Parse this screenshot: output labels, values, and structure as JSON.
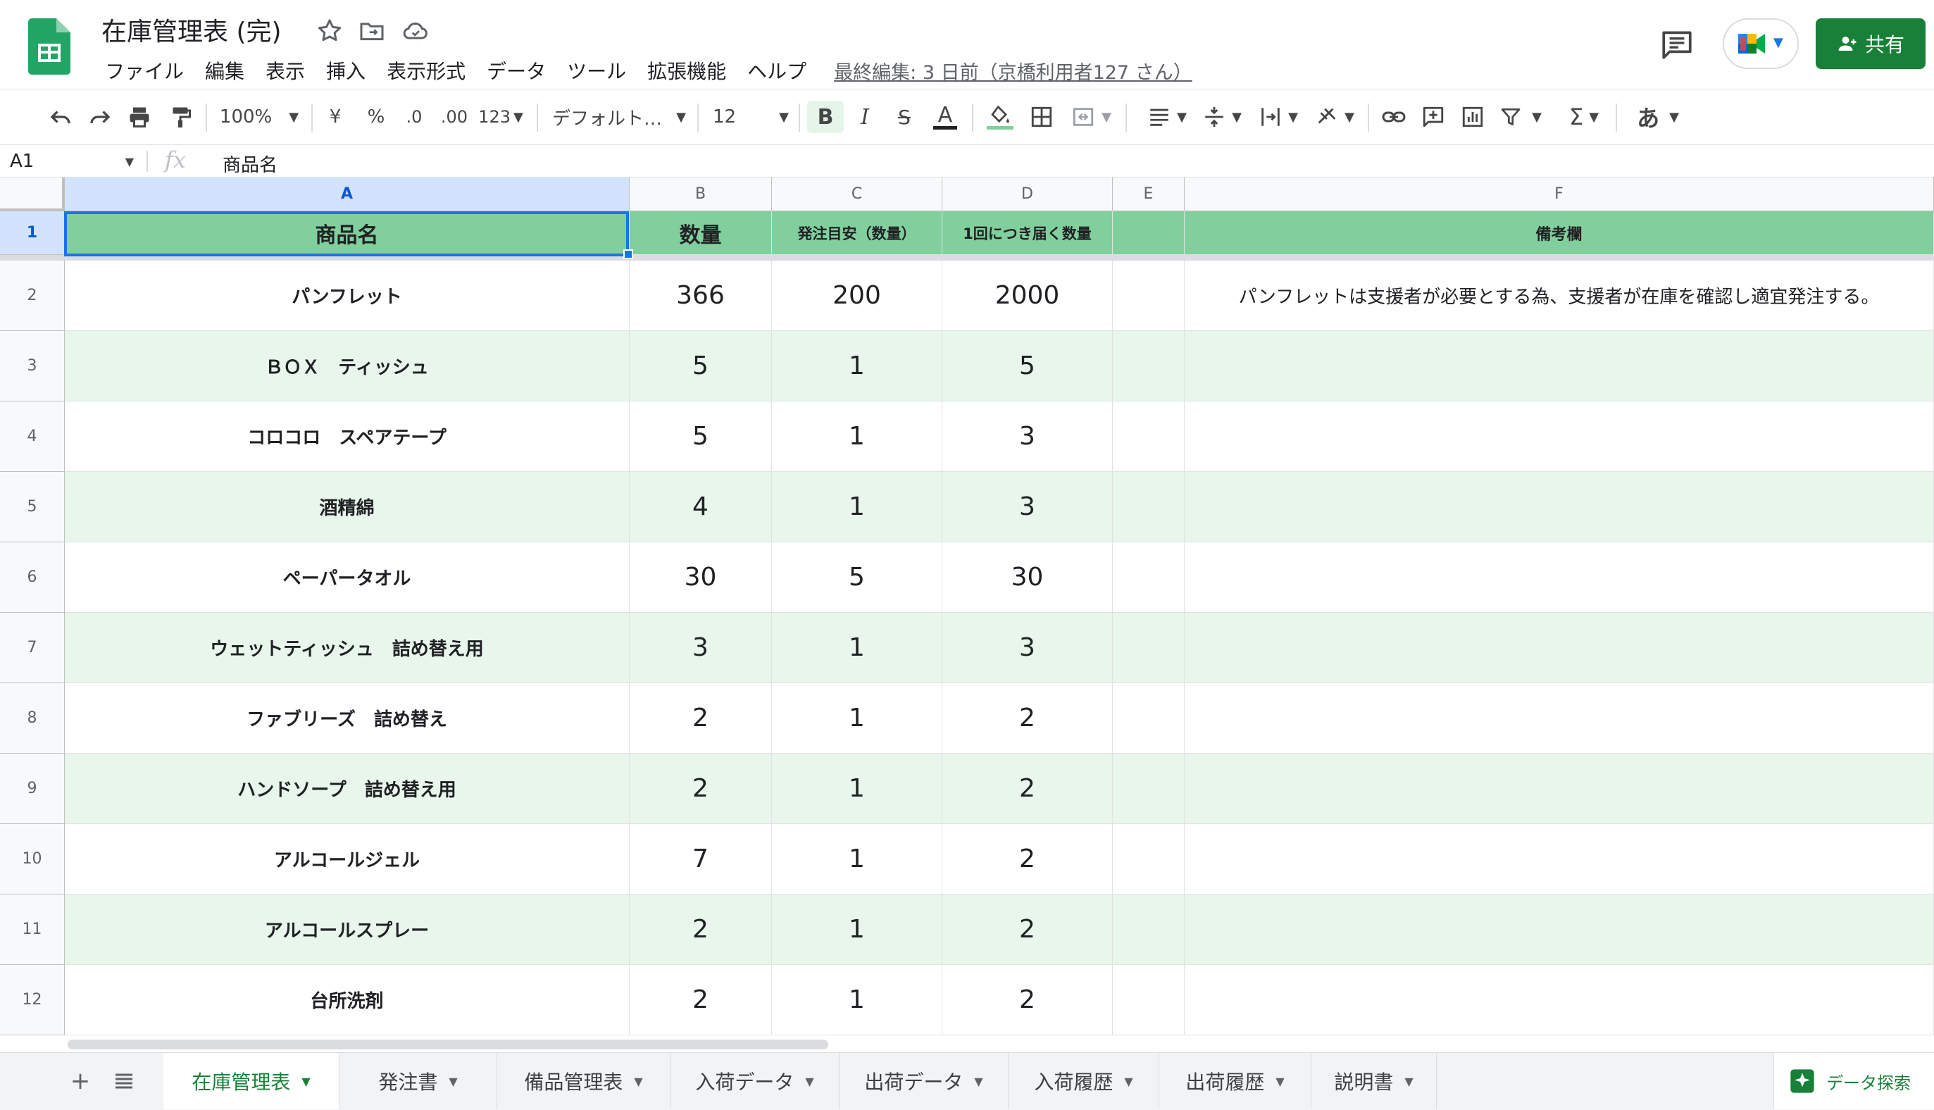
{
  "app": {
    "doc_title": "在庫管理表 (完)",
    "menu": [
      "ファイル",
      "編集",
      "表示",
      "挿入",
      "表示形式",
      "データ",
      "ツール",
      "拡張機能",
      "ヘルプ"
    ],
    "last_edit": "最終編集: 3 日前（京橋利用者127 さん）",
    "share_label": "共有",
    "accent_green": "#188038"
  },
  "toolbar": {
    "zoom": "100%",
    "currency": "¥",
    "percent": "%",
    "decrease_decimal": ".0",
    "increase_decimal": ".00",
    "more_formats": "123",
    "font_family": "デフォルト…",
    "font_size": "12",
    "bold": "B",
    "italic": "I",
    "strike": "S",
    "text_color": "A",
    "sum": "Σ",
    "input_tools": "あ"
  },
  "formula_bar": {
    "cell_ref": "A1",
    "fx": "fx",
    "content": "商品名"
  },
  "sheet": {
    "columns": [
      "A",
      "B",
      "C",
      "D",
      "E",
      "F"
    ],
    "header_row": {
      "row_number": "1",
      "name": "商品名",
      "qty": "数量",
      "order_point": "発注目安（数量）",
      "per_delivery": "1回につき届く数量",
      "e": "",
      "note": "備考欄"
    },
    "rows": [
      {
        "n": "2",
        "name": "パンフレット",
        "qty": "366",
        "order_point": "200",
        "per_delivery": "2000",
        "note": "パンフレットは支援者が必要とする為、支援者が在庫を確認し適宜発注する。"
      },
      {
        "n": "3",
        "name": "ＢＯＸ　ティッシュ",
        "qty": "5",
        "order_point": "1",
        "per_delivery": "5",
        "note": ""
      },
      {
        "n": "4",
        "name": "コロコロ　スペアテープ",
        "qty": "5",
        "order_point": "1",
        "per_delivery": "3",
        "note": ""
      },
      {
        "n": "5",
        "name": "酒精綿",
        "qty": "4",
        "order_point": "1",
        "per_delivery": "3",
        "note": ""
      },
      {
        "n": "6",
        "name": "ペーパータオル",
        "qty": "30",
        "order_point": "5",
        "per_delivery": "30",
        "note": ""
      },
      {
        "n": "7",
        "name": "ウェットティッシュ　詰め替え用",
        "qty": "3",
        "order_point": "1",
        "per_delivery": "3",
        "note": ""
      },
      {
        "n": "8",
        "name": "ファブリーズ　詰め替え",
        "qty": "2",
        "order_point": "1",
        "per_delivery": "2",
        "note": ""
      },
      {
        "n": "9",
        "name": "ハンドソープ　詰め替え用",
        "qty": "2",
        "order_point": "1",
        "per_delivery": "2",
        "note": ""
      },
      {
        "n": "10",
        "name": "アルコールジェル",
        "qty": "7",
        "order_point": "1",
        "per_delivery": "2",
        "note": ""
      },
      {
        "n": "11",
        "name": "アルコールスプレー",
        "qty": "2",
        "order_point": "1",
        "per_delivery": "2",
        "note": ""
      },
      {
        "n": "12",
        "name": "台所洗剤",
        "qty": "2",
        "order_point": "1",
        "per_delivery": "2",
        "note": ""
      }
    ],
    "header_fill": "#81cf9d",
    "band_fill": "#e8f6ec"
  },
  "tabs": {
    "sheets": [
      "在庫管理表",
      "発注書",
      "備品管理表",
      "入荷データ",
      "出荷データ",
      "入荷履歴",
      "出荷履歴",
      "説明書"
    ],
    "active": "在庫管理表",
    "explore_label": "データ探索"
  }
}
